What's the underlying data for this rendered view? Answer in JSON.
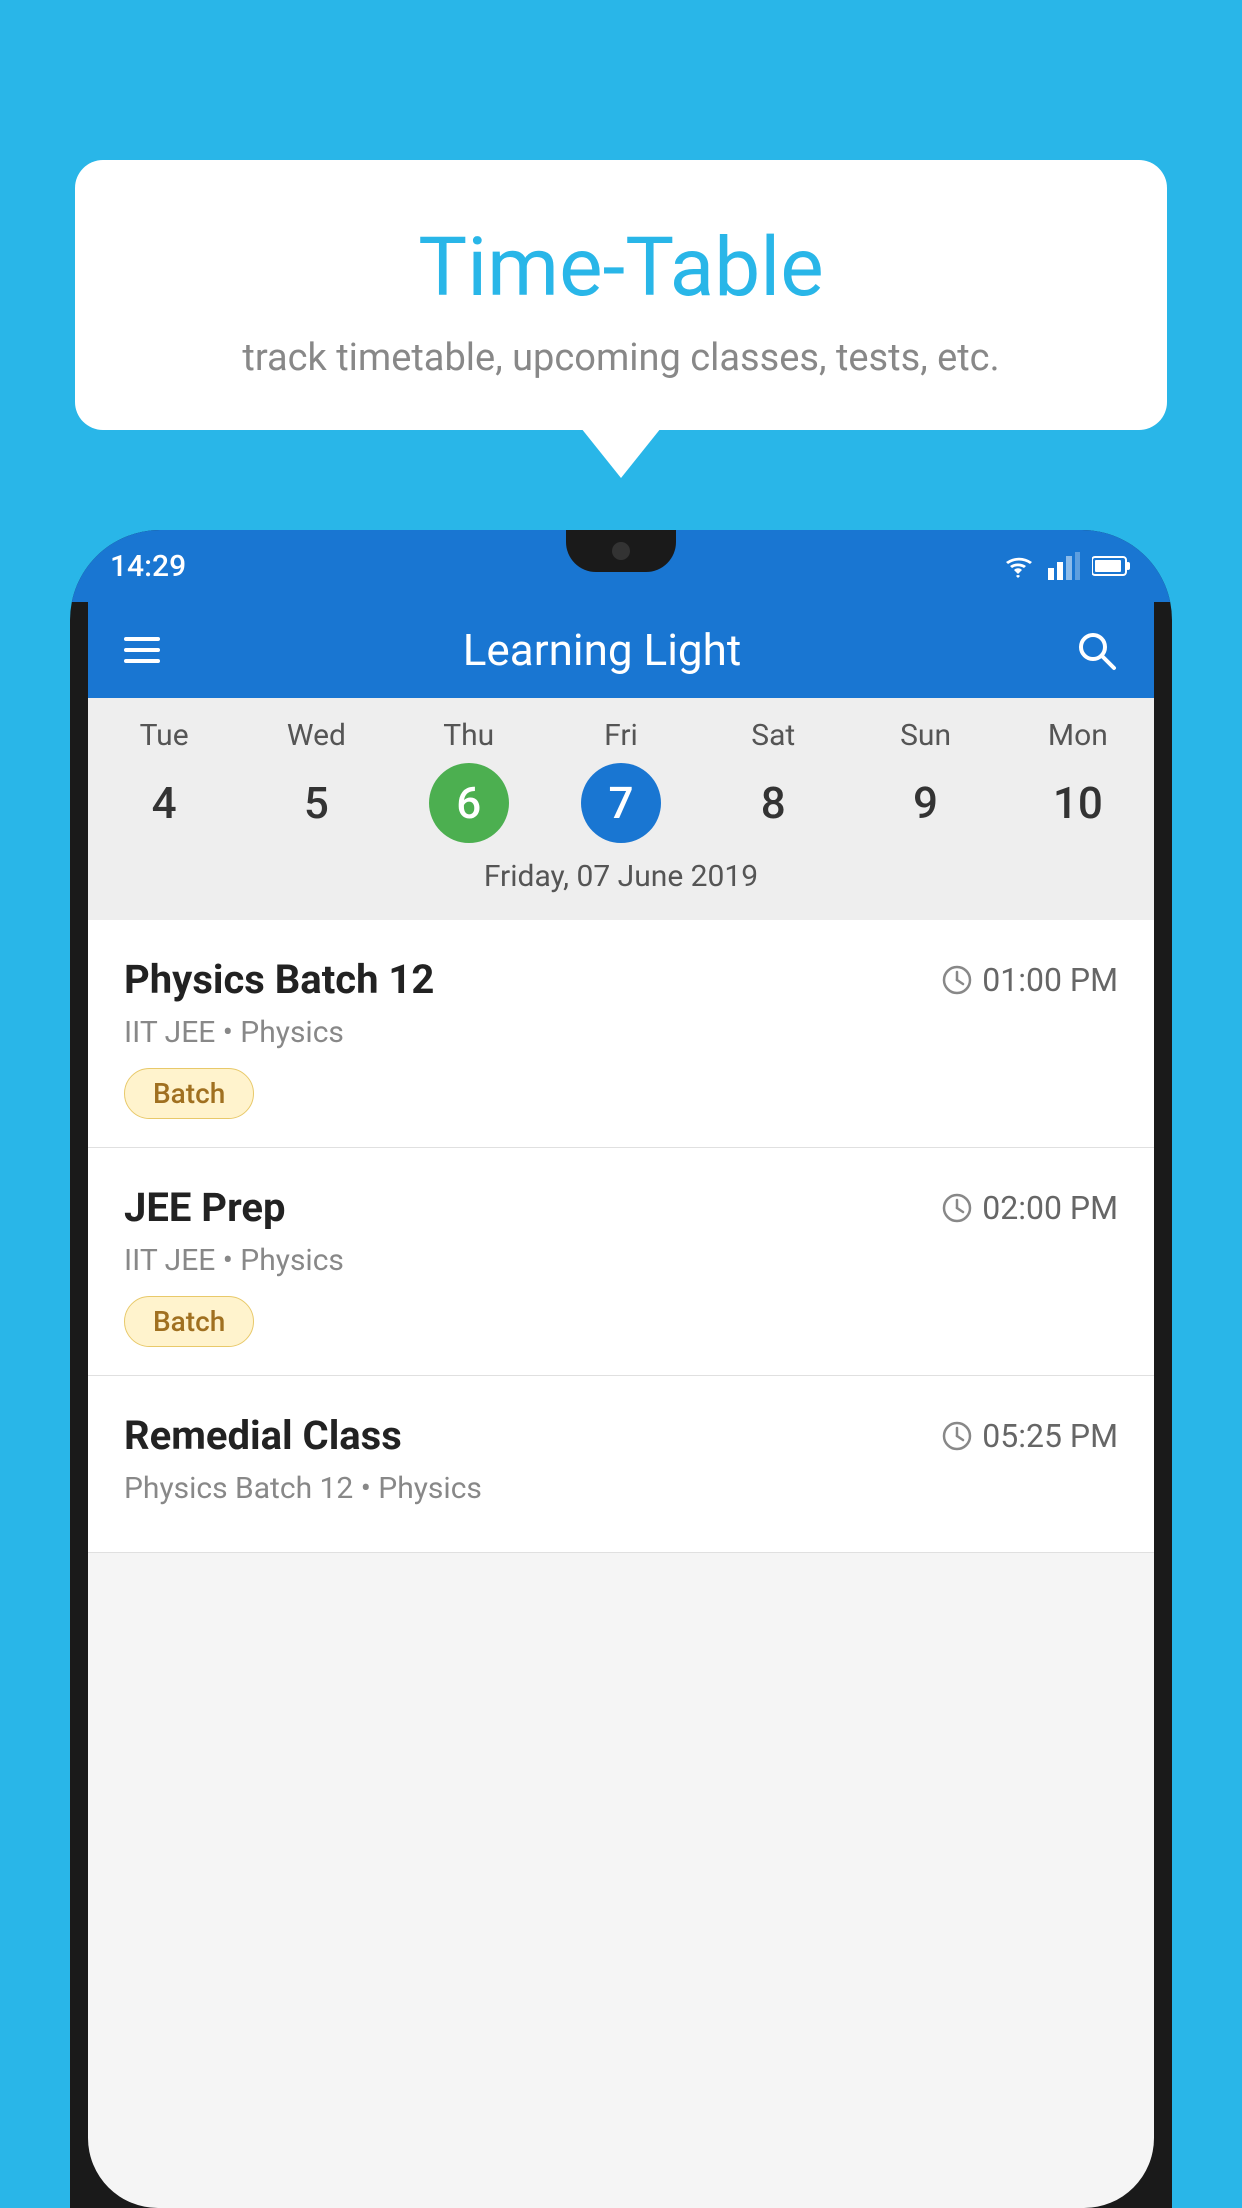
{
  "background_color": "#29B6E8",
  "tooltip": {
    "title": "Time-Table",
    "subtitle": "track timetable, upcoming classes, tests, etc."
  },
  "phone": {
    "status_bar": {
      "time": "14:29",
      "icons": [
        "wifi",
        "signal",
        "battery"
      ]
    },
    "app_bar": {
      "title": "Learning Light",
      "menu_label": "menu",
      "search_label": "search"
    },
    "calendar": {
      "days": [
        "Tue",
        "Wed",
        "Thu",
        "Fri",
        "Sat",
        "Sun",
        "Mon"
      ],
      "dates": [
        "4",
        "5",
        "6",
        "7",
        "8",
        "9",
        "10"
      ],
      "today_index": 2,
      "selected_index": 3,
      "date_label": "Friday, 07 June 2019"
    },
    "events": [
      {
        "title": "Physics Batch 12",
        "time": "01:00 PM",
        "subtitle": "IIT JEE • Physics",
        "badge": "Batch"
      },
      {
        "title": "JEE Prep",
        "time": "02:00 PM",
        "subtitle": "IIT JEE • Physics",
        "badge": "Batch"
      },
      {
        "title": "Remedial Class",
        "time": "05:25 PM",
        "subtitle": "Physics Batch 12 • Physics",
        "badge": ""
      }
    ]
  }
}
